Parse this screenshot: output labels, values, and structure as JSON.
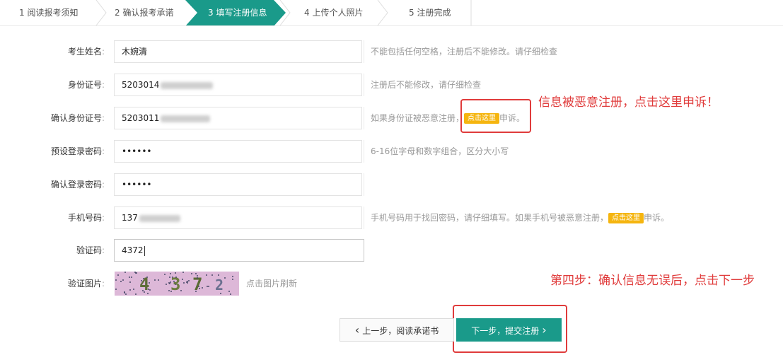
{
  "steps": [
    {
      "label": "1 阅读报考须知"
    },
    {
      "label": "2 确认报考承诺"
    },
    {
      "label": "3 填写注册信息"
    },
    {
      "label": "4 上传个人照片"
    },
    {
      "label": "5 注册完成"
    }
  ],
  "active_step": 3,
  "form": {
    "name": {
      "label": "考生姓名",
      "value": "木婉清",
      "hint": "不能包括任何空格，注册后不能修改。请仔细检查"
    },
    "id_number": {
      "label": "身份证号",
      "value": "5203014",
      "hint": "注册后不能修改，请仔细检查"
    },
    "id_confirm": {
      "label": "确认身份证号",
      "value": "5203011",
      "hint_before": "如果身份证被恶意注册，",
      "tag": "点击这里",
      "hint_after": "申诉。"
    },
    "password": {
      "label": "预设登录密码",
      "value": "••••••",
      "hint": "6-16位字母和数字组合，区分大小写"
    },
    "password_confirm": {
      "label": "确认登录密码",
      "value": "••••••"
    },
    "phone": {
      "label": "手机号码",
      "value": "137",
      "hint_before": "手机号码用于找回密码，请仔细填写。如果手机号被恶意注册，",
      "tag": "点击这里",
      "hint_after": "申诉。"
    },
    "captcha_code": {
      "label": "验证码",
      "value": "4372"
    },
    "captcha_image": {
      "label": "验证图片",
      "digits": [
        "4",
        "3",
        "7",
        "2"
      ],
      "hint": "点击图片刷新"
    },
    "colon": ":"
  },
  "annotations": {
    "complaint": "信息被恶意注册，点击这里申诉！",
    "step4": "第四步：确认信息无误后，点击下一步"
  },
  "buttons": {
    "prev_icon": "‹",
    "prev": "上一步，阅读承诺书",
    "next": "下一步，提交注册",
    "next_icon": "›"
  },
  "colors": {
    "accent": "#1a9a8a",
    "tag": "#f5b50f",
    "annotation": "#e03b3b"
  }
}
